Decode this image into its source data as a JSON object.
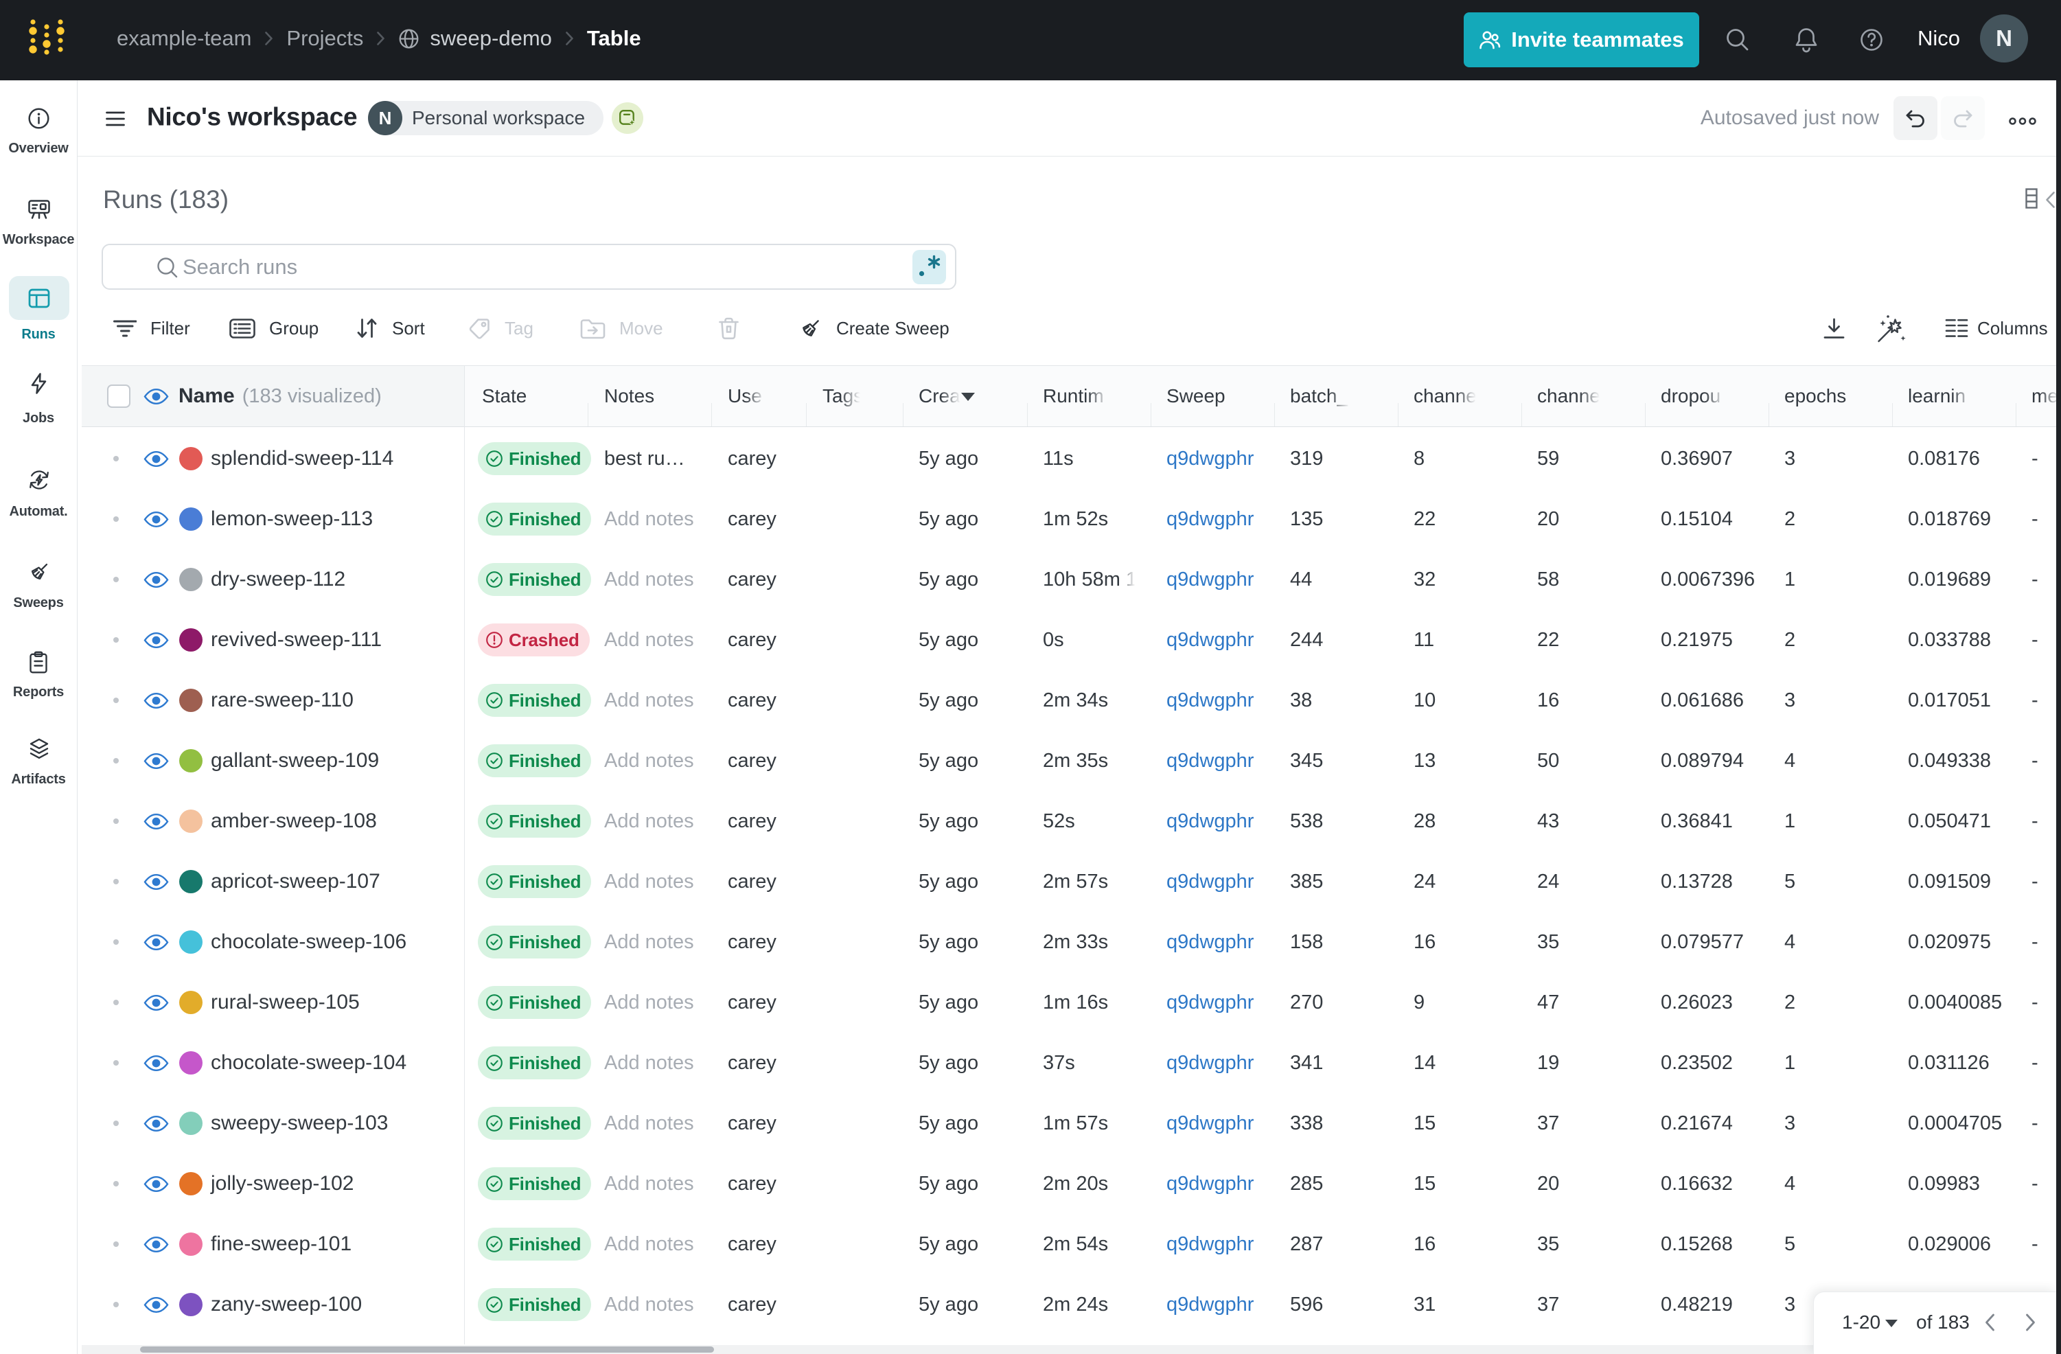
{
  "nav": {
    "breadcrumbs": [
      "example-team",
      "Projects",
      "sweep-demo",
      "Table"
    ],
    "invite_label": "Invite teammates",
    "user_name": "Nico",
    "avatar_initial": "N"
  },
  "sidebar": {
    "items": [
      {
        "label": "Overview",
        "icon": "overview-icon",
        "active": false
      },
      {
        "label": "Workspace",
        "icon": "workspace-icon",
        "active": false
      },
      {
        "label": "Runs",
        "icon": "runs-table-icon",
        "active": true
      },
      {
        "label": "Jobs",
        "icon": "jobs-icon",
        "active": false
      },
      {
        "label": "Automat.",
        "icon": "automations-icon",
        "active": false
      },
      {
        "label": "Sweeps",
        "icon": "sweeps-icon",
        "active": false
      },
      {
        "label": "Reports",
        "icon": "reports-icon",
        "active": false
      },
      {
        "label": "Artifacts",
        "icon": "artifacts-icon",
        "active": false
      }
    ]
  },
  "workspace_bar": {
    "title": "Nico's workspace",
    "badge_initial": "N",
    "badge_label": "Personal workspace",
    "autosave_status": "Autosaved just now"
  },
  "runs_panel": {
    "title": "Runs (183)",
    "search_placeholder": "Search runs",
    "toolbar": {
      "filter": "Filter",
      "group": "Group",
      "sort": "Sort",
      "tag": "Tag",
      "move": "Move",
      "create_sweep": "Create Sweep",
      "columns": "Columns"
    }
  },
  "table": {
    "name_header": "Name",
    "name_sub": "(183 visualized)",
    "columns": [
      {
        "label": "State",
        "fade": false,
        "sort": false
      },
      {
        "label": "Notes",
        "fade": false,
        "sort": false
      },
      {
        "label": "Use",
        "fade": true,
        "sort": false
      },
      {
        "label": "Tags",
        "fade": true,
        "sort": false
      },
      {
        "label": "Crea",
        "fade": true,
        "sort": true
      },
      {
        "label": "Runtim",
        "fade": true,
        "sort": false
      },
      {
        "label": "Sweep",
        "fade": false,
        "sort": false
      },
      {
        "label": "batch_",
        "fade": true,
        "sort": false
      },
      {
        "label": "channe",
        "fade": true,
        "sort": false
      },
      {
        "label": "channe",
        "fade": true,
        "sort": false
      },
      {
        "label": "dropou",
        "fade": true,
        "sort": false
      },
      {
        "label": "epochs",
        "fade": false,
        "sort": false
      },
      {
        "label": "learnin",
        "fade": true,
        "sort": false
      },
      {
        "label": "me",
        "fade": true,
        "sort": false
      }
    ],
    "rows": [
      {
        "name": "splendid-sweep-114",
        "color": "#e25a55",
        "state": "finished",
        "state_label": "Finished",
        "notes": "best ru…",
        "notes_placeholder": false,
        "user": "carey",
        "created": "5y ago",
        "runtime": "11s",
        "runtime_fade": false,
        "sweep": "q9dwgphr",
        "batch": "319",
        "ch1": "8",
        "ch2": "59",
        "dropout": "0.36907",
        "epochs": "3",
        "lr": "0.08176",
        "metric": "-"
      },
      {
        "name": "lemon-sweep-113",
        "color": "#4a7dd6",
        "state": "finished",
        "state_label": "Finished",
        "notes": "Add notes",
        "notes_placeholder": true,
        "user": "carey",
        "created": "5y ago",
        "runtime": "1m 52s",
        "runtime_fade": false,
        "sweep": "q9dwgphr",
        "batch": "135",
        "ch1": "22",
        "ch2": "20",
        "dropout": "0.15104",
        "epochs": "2",
        "lr": "0.018769",
        "metric": "-"
      },
      {
        "name": "dry-sweep-112",
        "color": "#a3a9ae",
        "state": "finished",
        "state_label": "Finished",
        "notes": "Add notes",
        "notes_placeholder": true,
        "user": "carey",
        "created": "5y ago",
        "runtime": "10h 58m 1",
        "runtime_fade": true,
        "sweep": "q9dwgphr",
        "batch": "44",
        "ch1": "32",
        "ch2": "58",
        "dropout": "0.0067396",
        "epochs": "1",
        "lr": "0.019689",
        "metric": "-"
      },
      {
        "name": "revived-sweep-111",
        "color": "#8e1a68",
        "state": "crashed",
        "state_label": "Crashed",
        "notes": "Add notes",
        "notes_placeholder": true,
        "user": "carey",
        "created": "5y ago",
        "runtime": "0s",
        "runtime_fade": false,
        "sweep": "q9dwgphr",
        "batch": "244",
        "ch1": "11",
        "ch2": "22",
        "dropout": "0.21975",
        "epochs": "2",
        "lr": "0.033788",
        "metric": "-"
      },
      {
        "name": "rare-sweep-110",
        "color": "#9e5f50",
        "state": "finished",
        "state_label": "Finished",
        "notes": "Add notes",
        "notes_placeholder": true,
        "user": "carey",
        "created": "5y ago",
        "runtime": "2m 34s",
        "runtime_fade": false,
        "sweep": "q9dwgphr",
        "batch": "38",
        "ch1": "10",
        "ch2": "16",
        "dropout": "0.061686",
        "epochs": "3",
        "lr": "0.017051",
        "metric": "-"
      },
      {
        "name": "gallant-sweep-109",
        "color": "#92bf41",
        "state": "finished",
        "state_label": "Finished",
        "notes": "Add notes",
        "notes_placeholder": true,
        "user": "carey",
        "created": "5y ago",
        "runtime": "2m 35s",
        "runtime_fade": false,
        "sweep": "q9dwgphr",
        "batch": "345",
        "ch1": "13",
        "ch2": "50",
        "dropout": "0.089794",
        "epochs": "4",
        "lr": "0.049338",
        "metric": "-"
      },
      {
        "name": "amber-sweep-108",
        "color": "#f4c29e",
        "state": "finished",
        "state_label": "Finished",
        "notes": "Add notes",
        "notes_placeholder": true,
        "user": "carey",
        "created": "5y ago",
        "runtime": "52s",
        "runtime_fade": false,
        "sweep": "q9dwgphr",
        "batch": "538",
        "ch1": "28",
        "ch2": "43",
        "dropout": "0.36841",
        "epochs": "1",
        "lr": "0.050471",
        "metric": "-"
      },
      {
        "name": "apricot-sweep-107",
        "color": "#17796c",
        "state": "finished",
        "state_label": "Finished",
        "notes": "Add notes",
        "notes_placeholder": true,
        "user": "carey",
        "created": "5y ago",
        "runtime": "2m 57s",
        "runtime_fade": false,
        "sweep": "q9dwgphr",
        "batch": "385",
        "ch1": "24",
        "ch2": "24",
        "dropout": "0.13728",
        "epochs": "5",
        "lr": "0.091509",
        "metric": "-"
      },
      {
        "name": "chocolate-sweep-106",
        "color": "#45c1da",
        "state": "finished",
        "state_label": "Finished",
        "notes": "Add notes",
        "notes_placeholder": true,
        "user": "carey",
        "created": "5y ago",
        "runtime": "2m 33s",
        "runtime_fade": false,
        "sweep": "q9dwgphr",
        "batch": "158",
        "ch1": "16",
        "ch2": "35",
        "dropout": "0.079577",
        "epochs": "4",
        "lr": "0.020975",
        "metric": "-"
      },
      {
        "name": "rural-sweep-105",
        "color": "#e2ac2a",
        "state": "finished",
        "state_label": "Finished",
        "notes": "Add notes",
        "notes_placeholder": true,
        "user": "carey",
        "created": "5y ago",
        "runtime": "1m 16s",
        "runtime_fade": false,
        "sweep": "q9dwgphr",
        "batch": "270",
        "ch1": "9",
        "ch2": "47",
        "dropout": "0.26023",
        "epochs": "2",
        "lr": "0.0040085",
        "metric": "-"
      },
      {
        "name": "chocolate-sweep-104",
        "color": "#c557ca",
        "state": "finished",
        "state_label": "Finished",
        "notes": "Add notes",
        "notes_placeholder": true,
        "user": "carey",
        "created": "5y ago",
        "runtime": "37s",
        "runtime_fade": false,
        "sweep": "q9dwgphr",
        "batch": "341",
        "ch1": "14",
        "ch2": "19",
        "dropout": "0.23502",
        "epochs": "1",
        "lr": "0.031126",
        "metric": "-"
      },
      {
        "name": "sweepy-sweep-103",
        "color": "#83ceba",
        "state": "finished",
        "state_label": "Finished",
        "notes": "Add notes",
        "notes_placeholder": true,
        "user": "carey",
        "created": "5y ago",
        "runtime": "1m 57s",
        "runtime_fade": false,
        "sweep": "q9dwgphr",
        "batch": "338",
        "ch1": "15",
        "ch2": "37",
        "dropout": "0.21674",
        "epochs": "3",
        "lr": "0.0004705",
        "metric": "-"
      },
      {
        "name": "jolly-sweep-102",
        "color": "#e47226",
        "state": "finished",
        "state_label": "Finished",
        "notes": "Add notes",
        "notes_placeholder": true,
        "user": "carey",
        "created": "5y ago",
        "runtime": "2m 20s",
        "runtime_fade": false,
        "sweep": "q9dwgphr",
        "batch": "285",
        "ch1": "15",
        "ch2": "20",
        "dropout": "0.16632",
        "epochs": "4",
        "lr": "0.09983",
        "metric": "-"
      },
      {
        "name": "fine-sweep-101",
        "color": "#ee74a0",
        "state": "finished",
        "state_label": "Finished",
        "notes": "Add notes",
        "notes_placeholder": true,
        "user": "carey",
        "created": "5y ago",
        "runtime": "2m 54s",
        "runtime_fade": false,
        "sweep": "q9dwgphr",
        "batch": "287",
        "ch1": "16",
        "ch2": "35",
        "dropout": "0.15268",
        "epochs": "5",
        "lr": "0.029006",
        "metric": "-"
      },
      {
        "name": "zany-sweep-100",
        "color": "#7d52c0",
        "state": "finished",
        "state_label": "Finished",
        "notes": "Add notes",
        "notes_placeholder": true,
        "user": "carey",
        "created": "5y ago",
        "runtime": "2m 24s",
        "runtime_fade": false,
        "sweep": "q9dwgphr",
        "batch": "596",
        "ch1": "31",
        "ch2": "37",
        "dropout": "0.48219",
        "epochs": "3",
        "lr": "",
        "metric": ""
      }
    ]
  },
  "pagination": {
    "range": "1-20",
    "of_total": "of 183"
  },
  "colors": {
    "accent_teal": "#14a9ba",
    "sidebar_active": "#0b7c8c",
    "link_blue": "#2e78c7",
    "finished_bg": "#d7f3e1",
    "finished_text": "#0e8a4d",
    "crashed_bg": "#fcdee2",
    "crashed_text": "#c22543",
    "navbar_bg": "#1a1d21",
    "logo_gold": "#ffc933"
  }
}
